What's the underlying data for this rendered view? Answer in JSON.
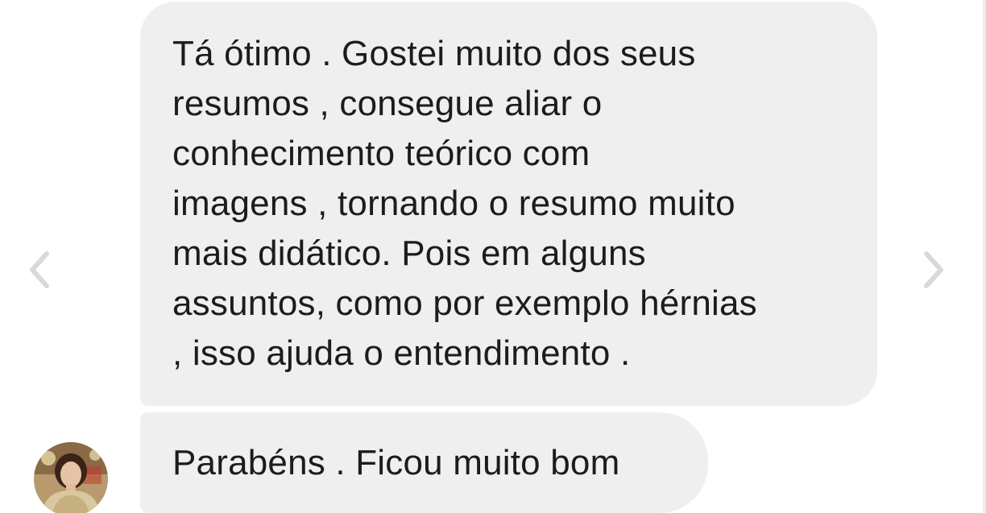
{
  "conversation": {
    "messages": [
      {
        "lines": [
          "Tá ótimo . Gostei muito dos seus",
          "resumos , consegue aliar o",
          "conhecimento teórico com",
          "imagens , tornando o resumo muito",
          "mais didático. Pois em alguns",
          "assuntos, como por exemplo hérnias",
          ", isso ajuda o entendimento ."
        ]
      },
      {
        "text": "Parabéns . Ficou muito bom"
      }
    ]
  },
  "icons": {
    "prev": "chevron-left-icon",
    "next": "chevron-right-icon",
    "avatar": "user-avatar"
  },
  "colors": {
    "bubble_bg": "#efefef",
    "text": "#1c1c1c",
    "arrow": "#d9d9d9",
    "page_bg": "#ffffff"
  }
}
